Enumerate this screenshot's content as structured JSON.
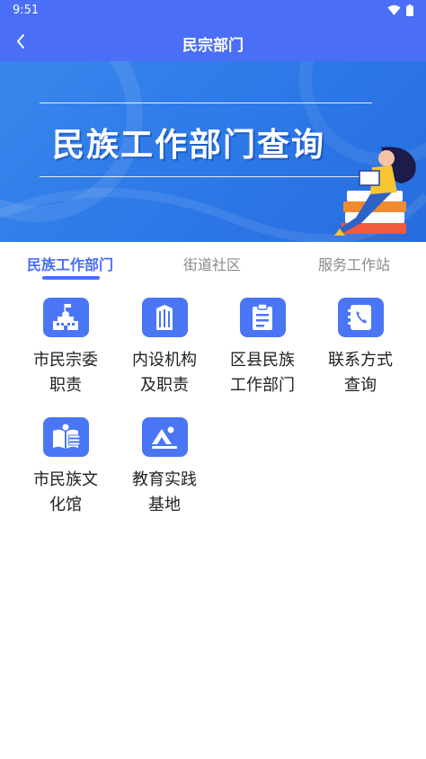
{
  "status_bar": {
    "time": "9:51"
  },
  "navbar": {
    "title": "民宗部门"
  },
  "banner": {
    "headline": "民族工作部门查询"
  },
  "tabs": [
    {
      "label": "民族工作部门",
      "active": true
    },
    {
      "label": "街道社区",
      "active": false
    },
    {
      "label": "服务工作站",
      "active": false
    }
  ],
  "grid_items": [
    {
      "line1": "市民宗委",
      "line2": "职责",
      "icon": "government-building-icon"
    },
    {
      "line1": "内设机构",
      "line2": "及职责",
      "icon": "office-building-icon"
    },
    {
      "line1": "区县民族",
      "line2": "工作部门",
      "icon": "clipboard-icon"
    },
    {
      "line1": "联系方式",
      "line2": "查询",
      "icon": "phone-book-icon"
    },
    {
      "line1": "市民族文",
      "line2": "化馆",
      "icon": "reading-book-icon"
    },
    {
      "line1": "教育实践",
      "line2": "基地",
      "icon": "mountain-image-icon"
    }
  ],
  "colors": {
    "primary": "#4a6ef5",
    "icon_bg": "#4a76f6",
    "inactive_tab": "#8a8a8a"
  }
}
